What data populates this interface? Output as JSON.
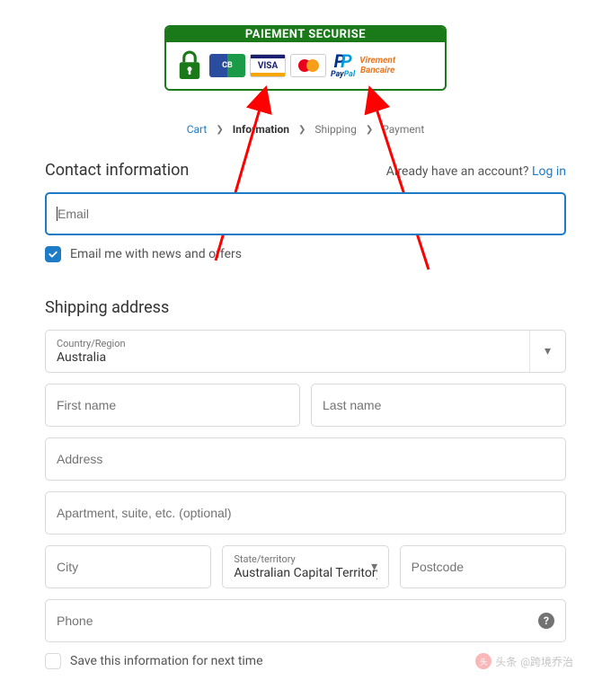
{
  "banner": {
    "title": "PAIEMENT SECURISE",
    "cards": {
      "cb": "CB",
      "visa": "VISA",
      "mastercard": "MasterCard"
    },
    "paypal": "PayPal",
    "virement_line1": "Virement",
    "virement_line2": "Bancaire"
  },
  "breadcrumb": {
    "cart": "Cart",
    "information": "Information",
    "shipping": "Shipping",
    "payment": "Payment"
  },
  "contact": {
    "heading": "Contact information",
    "already": "Already have an account?",
    "login": "Log in",
    "email_placeholder": "Email",
    "newsletter_label": "Email me with news and offers",
    "newsletter_checked": true
  },
  "shipping": {
    "heading": "Shipping address",
    "country_label": "Country/Region",
    "country_value": "Australia",
    "first_name_placeholder": "First name",
    "last_name_placeholder": "Last name",
    "address_placeholder": "Address",
    "apartment_placeholder": "Apartment, suite, etc. (optional)",
    "city_placeholder": "City",
    "state_label": "State/territory",
    "state_value": "Australian Capital Territory",
    "postcode_placeholder": "Postcode",
    "phone_placeholder": "Phone",
    "save_label": "Save this information for next time",
    "save_checked": false
  },
  "watermark": {
    "prefix": "头条",
    "handle": "@跨境乔治"
  }
}
